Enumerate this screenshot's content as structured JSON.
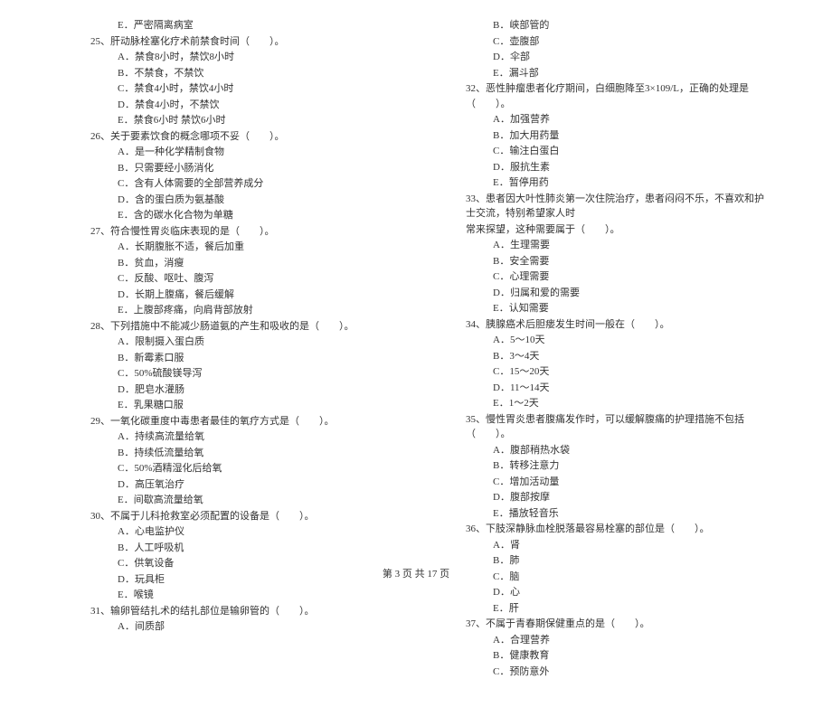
{
  "left_column": [
    {
      "type": "option",
      "text": "E．严密隔离病室"
    },
    {
      "type": "question",
      "text": "25、肝动脉栓塞化疗术前禁食时间（　　）。"
    },
    {
      "type": "option",
      "text": "A．禁食8小时，禁饮8小时"
    },
    {
      "type": "option",
      "text": "B．不禁食，不禁饮"
    },
    {
      "type": "option",
      "text": "C．禁食4小时，禁饮4小时"
    },
    {
      "type": "option",
      "text": "D．禁食4小时，不禁饮"
    },
    {
      "type": "option",
      "text": "E．禁食6小时 禁饮6小时"
    },
    {
      "type": "question",
      "text": "26、关于要素饮食的概念哪项不妥（　　）。"
    },
    {
      "type": "option",
      "text": "A．是一种化学精制食物"
    },
    {
      "type": "option",
      "text": "B．只需要经小肠消化"
    },
    {
      "type": "option",
      "text": "C．含有人体需要的全部营养成分"
    },
    {
      "type": "option",
      "text": "D．含的蛋白质为氨基酸"
    },
    {
      "type": "option",
      "text": "E．含的碳水化合物为单糖"
    },
    {
      "type": "question",
      "text": "27、符合慢性胃炎临床表现的是（　　）。"
    },
    {
      "type": "option",
      "text": "A．长期腹胀不适，餐后加重"
    },
    {
      "type": "option",
      "text": "B．贫血，消瘦"
    },
    {
      "type": "option",
      "text": "C．反酸、呕吐、腹泻"
    },
    {
      "type": "option",
      "text": "D．长期上腹痛，餐后缓解"
    },
    {
      "type": "option",
      "text": "E．上腹部疼痛，向肩背部放射"
    },
    {
      "type": "question",
      "text": "28、下列措施中不能减少肠道氨的产生和吸收的是（　　）。"
    },
    {
      "type": "option",
      "text": "A．限制摄入蛋白质"
    },
    {
      "type": "option",
      "text": "B．新霉素口服"
    },
    {
      "type": "option",
      "text": "C．50%硫酸镁导泻"
    },
    {
      "type": "option",
      "text": "D．肥皂水灌肠"
    },
    {
      "type": "option",
      "text": "E．乳果糖口服"
    },
    {
      "type": "question",
      "text": "29、一氧化碳重度中毒患者最佳的氧疗方式是（　　）。"
    },
    {
      "type": "option",
      "text": "A．持续高流量给氧"
    },
    {
      "type": "option",
      "text": "B．持续低流量给氧"
    },
    {
      "type": "option",
      "text": "C．50%酒精湿化后给氧"
    },
    {
      "type": "option",
      "text": "D．高压氧治疗"
    },
    {
      "type": "option",
      "text": "E．间歇高流量给氧"
    },
    {
      "type": "question",
      "text": "30、不属于儿科抢救室必须配置的设备是（　　）。"
    },
    {
      "type": "option",
      "text": "A．心电监护仪"
    },
    {
      "type": "option",
      "text": "B．人工呼吸机"
    },
    {
      "type": "option",
      "text": "C．供氧设备"
    },
    {
      "type": "option",
      "text": "D．玩具柜"
    },
    {
      "type": "option",
      "text": "E．喉镜"
    },
    {
      "type": "question",
      "text": "31、输卵管结扎术的结扎部位是输卵管的（　　）。"
    },
    {
      "type": "option",
      "text": "A．间质部"
    }
  ],
  "right_column": [
    {
      "type": "option",
      "text": "B．峡部管的"
    },
    {
      "type": "option",
      "text": "C．壶腹部"
    },
    {
      "type": "option",
      "text": "D．伞部"
    },
    {
      "type": "option",
      "text": "E．漏斗部"
    },
    {
      "type": "question",
      "text": "32、恶性肿瘤患者化疗期间，白细胞降至3×109/L，正确的处理是（　　）。"
    },
    {
      "type": "option",
      "text": "A．加强营养"
    },
    {
      "type": "option",
      "text": "B．加大用药量"
    },
    {
      "type": "option",
      "text": "C．输注白蛋白"
    },
    {
      "type": "option",
      "text": "D．服抗生素"
    },
    {
      "type": "option",
      "text": "E．暂停用药"
    },
    {
      "type": "question",
      "text": "33、患者因大叶性肺炎第一次住院治疗，患者闷闷不乐，不喜欢和护士交流，特别希望家人时"
    },
    {
      "type": "continuation",
      "text": "常来探望，这种需要属于（　　）。"
    },
    {
      "type": "option",
      "text": "A．生理需要"
    },
    {
      "type": "option",
      "text": "B．安全需要"
    },
    {
      "type": "option",
      "text": "C．心理需要"
    },
    {
      "type": "option",
      "text": "D．归属和爱的需要"
    },
    {
      "type": "option",
      "text": "E．认知需要"
    },
    {
      "type": "question",
      "text": "34、胰腺癌术后胆瘘发生时间一般在（　　）。"
    },
    {
      "type": "option",
      "text": "A．5～10天"
    },
    {
      "type": "option",
      "text": "B．3～4天"
    },
    {
      "type": "option",
      "text": "C．15～20天"
    },
    {
      "type": "option",
      "text": "D．11～14天"
    },
    {
      "type": "option",
      "text": "E．1～2天"
    },
    {
      "type": "question",
      "text": "35、慢性胃炎患者腹痛发作时，可以缓解腹痛的护理措施不包括（　　）。"
    },
    {
      "type": "option",
      "text": "A．腹部稍热水袋"
    },
    {
      "type": "option",
      "text": "B．转移注意力"
    },
    {
      "type": "option",
      "text": "C．增加活动量"
    },
    {
      "type": "option",
      "text": "D．腹部按摩"
    },
    {
      "type": "option",
      "text": "E．播放轻音乐"
    },
    {
      "type": "question",
      "text": "36、下肢深静脉血栓脱落最容易栓塞的部位是（　　）。"
    },
    {
      "type": "option",
      "text": "A．肾"
    },
    {
      "type": "option",
      "text": "B．肺"
    },
    {
      "type": "option",
      "text": "C．脑"
    },
    {
      "type": "option",
      "text": "D．心"
    },
    {
      "type": "option",
      "text": "E．肝"
    },
    {
      "type": "question",
      "text": "37、不属于青春期保健重点的是（　　）。"
    },
    {
      "type": "option",
      "text": "A．合理营养"
    },
    {
      "type": "option",
      "text": "B．健康教育"
    },
    {
      "type": "option",
      "text": "C．预防意外"
    }
  ],
  "footer": {
    "text": "第 3 页 共 17 页"
  }
}
